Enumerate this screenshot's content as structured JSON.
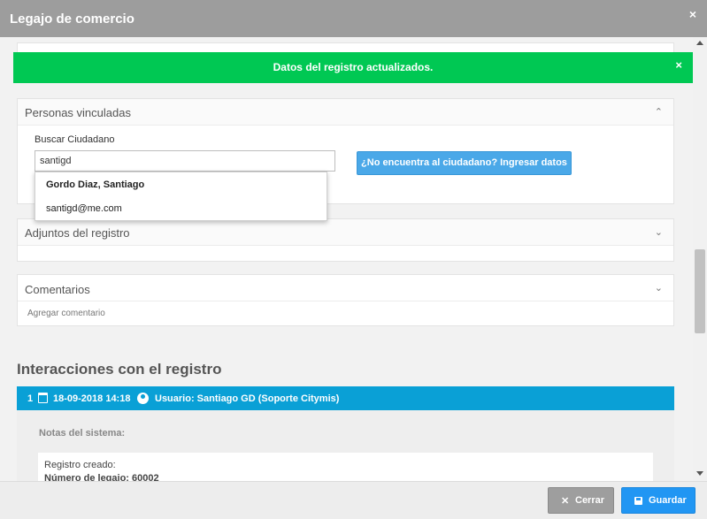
{
  "window": {
    "title": "Legajo de comercio",
    "close_glyph": "×"
  },
  "toast": {
    "message": "Datos del registro actualizados.",
    "close_glyph": "×"
  },
  "personas": {
    "title": "Personas vinculadas",
    "search_label": "Buscar Ciudadano",
    "search_value": "santigd",
    "link_button": "¿No encuentra al ciudadano? Ingresar datos",
    "suggestions": [
      {
        "label": "Gordo Diaz, Santiago"
      },
      {
        "label": "santigd@me.com"
      }
    ]
  },
  "adjuntos": {
    "title": "Adjuntos del registro"
  },
  "comentarios": {
    "title": "Comentarios",
    "add_link": "Agregar comentario"
  },
  "interacciones": {
    "heading": "Interacciones con el registro",
    "entry": {
      "index": "1",
      "date": "18-09-2018 14:18",
      "user": "Usuario: Santiago GD (Soporte Citymis)",
      "notes_label": "Notas del sistema:",
      "lines": [
        "Registro creado:",
        "Número de legajo: 60002"
      ]
    }
  },
  "footer": {
    "close_label": "Cerrar",
    "save_label": "Guardar"
  },
  "icons": {
    "chevron_up": "chevron-up-icon",
    "chevron_down": "chevron-down-icon",
    "calendar": "calendar-icon",
    "user": "user-circle-icon",
    "save": "save-icon",
    "close": "close-icon"
  },
  "colors": {
    "titlebar": "#9d9d9d",
    "toast": "#00c853",
    "interaction_bar": "#0aa0d6",
    "link_button": "#4aa8e8",
    "save_button": "#2196f3",
    "close_button": "#9e9e9e"
  }
}
